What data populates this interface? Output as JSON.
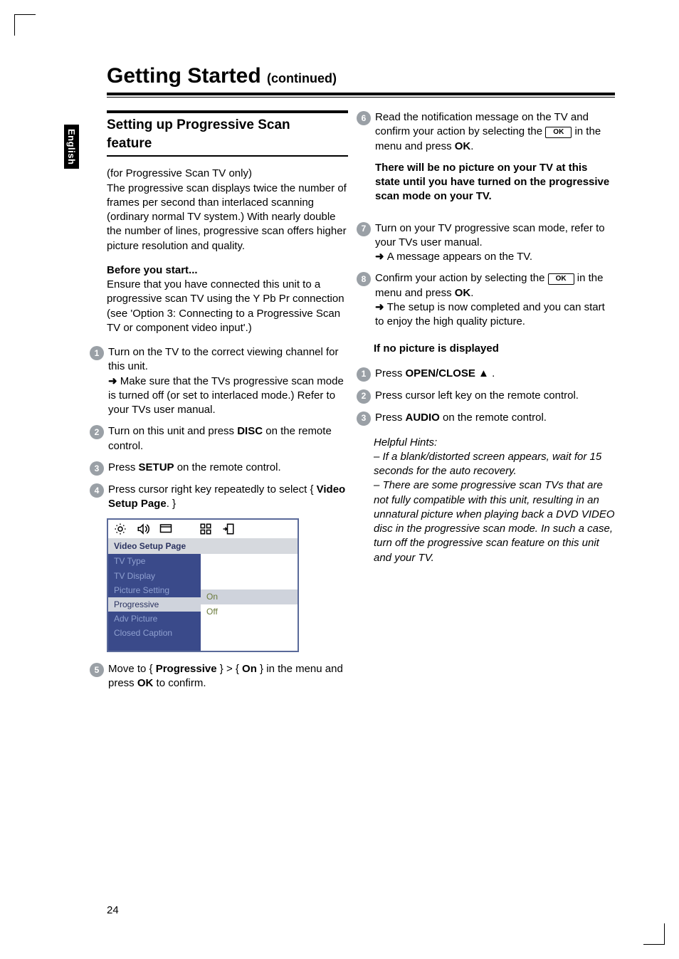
{
  "pageTitle": "Getting Started",
  "pageTitleCont": "(continued)",
  "sideTab": "English",
  "pageNumber": "24",
  "left": {
    "sectionHead1": "Setting up Progressive Scan",
    "sectionHead2": "feature",
    "intro": "(for Progressive Scan TV only)\nThe progressive scan displays twice the number of frames per second than interlaced scanning (ordinary normal TV system.) With nearly double the number of lines, progressive scan offers higher picture resolution and quality.",
    "beforeHead": "Before you start...",
    "beforeBody": "Ensure that you have connected this unit to a progressive scan TV using the Y Pb Pr connection (see 'Option 3: Connecting to a Progressive Scan TV or component video input'.)",
    "step1a": "Turn on the TV to the correct viewing channel for this unit.",
    "step1b": "Make sure that the TVs progressive scan mode is turned off (or set to interlaced mode.) Refer to your TVs user manual.",
    "step2a": "Turn on this unit and press ",
    "step2disc": "DISC",
    "step2b": " on the remote control.",
    "step3a": "Press ",
    "step3setup": "SETUP",
    "step3b": " on the remote control.",
    "step4a": "Press cursor right key repeatedly to select { ",
    "step4vsp": "Video Setup Page",
    "step4b": ". }",
    "step5a": "Move to { ",
    "step5prog": "Progressive",
    "step5b": " } > { ",
    "step5on": "On",
    "step5c": " } in the menu and press ",
    "step5ok": "OK",
    "step5d": " to confirm."
  },
  "menu": {
    "header": "Video Setup Page",
    "items": [
      "TV Type",
      "TV Display",
      "Picture Setting",
      "Progressive",
      "Adv Picture",
      "Closed Caption"
    ],
    "hlIndex": 3,
    "rightItems": [
      "On",
      "Off"
    ],
    "rightHlIndex": 0
  },
  "right": {
    "step6a": "Read the notification message on the TV and confirm your action by selecting the ",
    "ok": "OK",
    "step6b": " in the menu and press ",
    "step6ok2": "OK",
    "step6c": ".",
    "step6note": "There will be no picture on your TV at this state until you have turned on the progressive scan mode on your TV.",
    "step7a": "Turn on your TV progressive scan mode, refer to your TVs user manual.",
    "step7b": "A message appears on the TV.",
    "step8a": "Confirm your action by selecting the ",
    "step8b": " in the menu and press ",
    "step8ok2": "OK",
    "step8c": ".",
    "step8d": "The setup is now completed and you can start to enjoy the high quality picture.",
    "noPicHead": "If no picture is displayed",
    "np1a": "Press ",
    "np1oc": "OPEN/CLOSE",
    "np1b": " ",
    "np2": "Press cursor left key on the remote control.",
    "np3a": "Press ",
    "np3audio": "AUDIO",
    "np3b": " on the remote control.",
    "hintsHead": "Helpful Hints:",
    "hint1": "– If a blank/distorted screen appears, wait for 15 seconds for the auto recovery.",
    "hint2": "– There are some progressive scan TVs that are not fully compatible with this unit, resulting in an unnatural picture when playing back a DVD VIDEO disc in the progressive scan mode. In such a case, turn off the progressive scan feature on this unit and your TV."
  }
}
